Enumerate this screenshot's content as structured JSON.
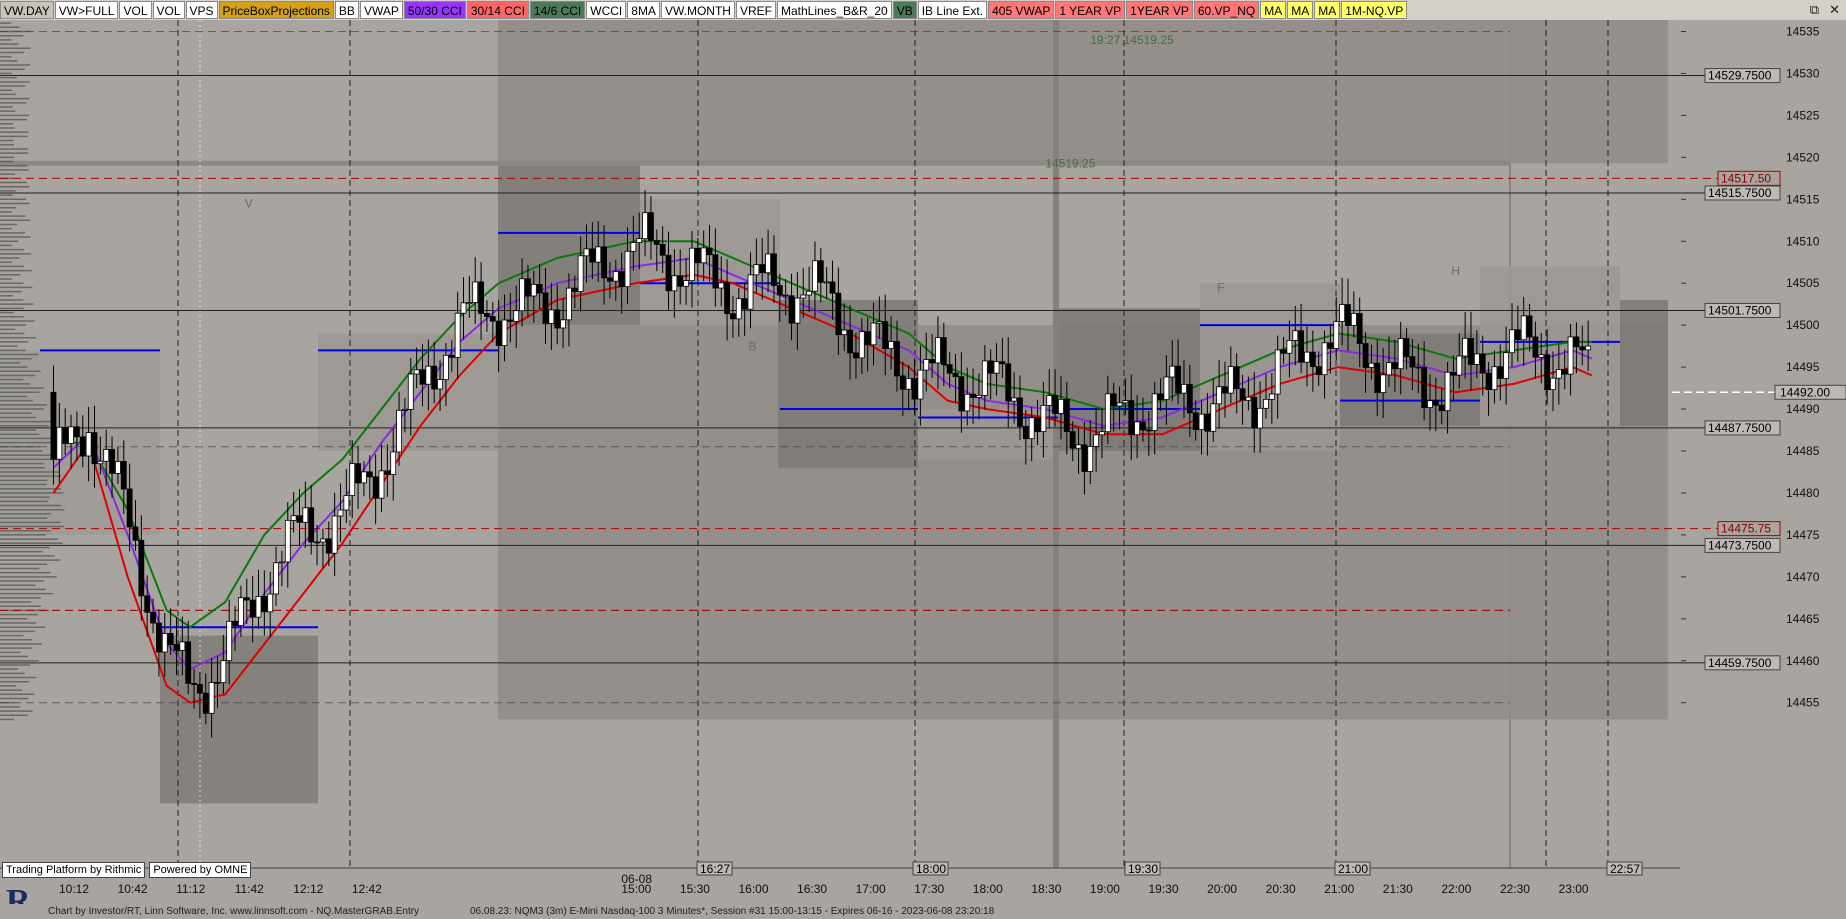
{
  "toolbar": {
    "buttons": [
      {
        "label": "VW.DAY",
        "bg": "#c8c4bc"
      },
      {
        "label": "VW>FULL",
        "bg": "#ffffff"
      },
      {
        "label": "VOL",
        "bg": "#ffffff"
      },
      {
        "label": "VOL",
        "bg": "#ffffff"
      },
      {
        "label": "VPS",
        "bg": "#ffffff"
      },
      {
        "label": "PriceBoxProjections",
        "bg": "#d4a017"
      },
      {
        "label": "BB",
        "bg": "#ffffff"
      },
      {
        "label": "VWAP",
        "bg": "#ffffff"
      },
      {
        "label": "50/30 CCI",
        "bg": "#9933ff"
      },
      {
        "label": "30/14 CCI",
        "bg": "#ff6666"
      },
      {
        "label": "14/6 CCI",
        "bg": "#4a7a5a"
      },
      {
        "label": "WCCI",
        "bg": "#ffffff"
      },
      {
        "label": "8MA",
        "bg": "#ffffff"
      },
      {
        "label": "VW.MONTH",
        "bg": "#ffffff"
      },
      {
        "label": "VREF",
        "bg": "#ffffff"
      },
      {
        "label": "MathLines_B&R_20",
        "bg": "#ffffff"
      },
      {
        "label": "VB",
        "bg": "#4a7a5a"
      },
      {
        "label": "IB Line Ext.",
        "bg": "#ffffff"
      },
      {
        "label": "405 VWAP",
        "bg": "#ff7777"
      },
      {
        "label": "1 YEAR VP",
        "bg": "#ff7777"
      },
      {
        "label": "1YEAR VP",
        "bg": "#ff7777"
      },
      {
        "label": "60.VP_NQ",
        "bg": "#ff7777"
      },
      {
        "label": "MA",
        "bg": "#ffff66"
      },
      {
        "label": "MA",
        "bg": "#ffff66"
      },
      {
        "label": "MA",
        "bg": "#ffff66"
      },
      {
        "label": "1M-NQ.VP",
        "bg": "#ffff66"
      }
    ],
    "window_controls": [
      "restore-icon",
      "close-icon"
    ]
  },
  "footer": {
    "credit": "Chart by Investor/RT, Linn Software, Inc. www.linnsoft.com - NQ.MasterGRAB.Entry",
    "session": "06.08.23: NQM3 (3m) E-Mini Nasdaq-100 3 Minutes*, Session #31 15:00-13:15 - Expires 06-16 - 2023-06-08 23:20:18",
    "platform": "Trading Platform by Rithmic",
    "powered": "Powered by OMNE"
  },
  "chart_data": {
    "type": "candlestick",
    "symbol": "NQM3",
    "timeframe": "3 Minutes",
    "price_axis": {
      "ticks": [
        14535,
        14530,
        14525,
        14520,
        14515,
        14510,
        14505,
        14500,
        14495,
        14490,
        14485,
        14480,
        14475,
        14470,
        14465,
        14460,
        14455
      ],
      "range": [
        14452.5,
        14537
      ]
    },
    "time_axis": {
      "ticks": [
        {
          "t": "10:12",
          "min": 612
        },
        {
          "t": "10:42",
          "min": 642
        },
        {
          "t": "11:12",
          "min": 672
        },
        {
          "t": "11:42",
          "min": 702
        },
        {
          "t": "12:12",
          "min": 732
        },
        {
          "t": "12:42",
          "min": 762
        },
        {
          "t": "15:00",
          "min": 900,
          "sub": "06-08"
        },
        {
          "t": "15:30",
          "min": 930
        },
        {
          "t": "16:00",
          "min": 960
        },
        {
          "t": "16:30",
          "min": 990
        },
        {
          "t": "17:00",
          "min": 1020
        },
        {
          "t": "17:30",
          "min": 1050
        },
        {
          "t": "18:00",
          "min": 1080
        },
        {
          "t": "18:30",
          "min": 1110
        },
        {
          "t": "19:00",
          "min": 1140
        },
        {
          "t": "19:30",
          "min": 1170
        },
        {
          "t": "20:00",
          "min": 1200
        },
        {
          "t": "20:30",
          "min": 1230
        },
        {
          "t": "21:00",
          "min": 1260
        },
        {
          "t": "21:30",
          "min": 1290
        },
        {
          "t": "22:00",
          "min": 1320
        },
        {
          "t": "22:30",
          "min": 1350
        },
        {
          "t": "23:00",
          "min": 1380
        }
      ],
      "session_markers": [
        "16:27",
        "18:00",
        "19:30",
        "21:00",
        "22:57"
      ]
    },
    "price_labels": [
      {
        "price": 14529.75,
        "text": "14529.7500",
        "style": "solid"
      },
      {
        "price": 14517.5,
        "text": "14517.50",
        "style": "red"
      },
      {
        "price": 14515.75,
        "text": "14515.7500",
        "style": "solid"
      },
      {
        "price": 14501.75,
        "text": "14501.7500",
        "style": "solid"
      },
      {
        "price": 14492,
        "text": "14492.00",
        "style": "current"
      },
      {
        "price": 14487.75,
        "text": "14487.7500",
        "style": "solid"
      },
      {
        "price": 14475.75,
        "text": "14475.75",
        "style": "red"
      },
      {
        "price": 14473.75,
        "text": "14473.7500",
        "style": "solid"
      },
      {
        "price": 14459.75,
        "text": "14459.7500",
        "style": "solid"
      }
    ],
    "annotations": [
      {
        "text": "19:27  14519.25",
        "min": 1133,
        "price": 14534
      },
      {
        "text": "14519.25",
        "min": 1110,
        "price": 14519.25
      }
    ],
    "period_letters": [
      {
        "letter": "V",
        "min": 702,
        "price": 14514
      },
      {
        "letter": "B",
        "min": 960,
        "price": 14497
      },
      {
        "letter": "F",
        "min": 1200,
        "price": 14504
      },
      {
        "letter": "H",
        "min": 1320,
        "price": 14506
      }
    ],
    "series": [
      {
        "name": "green",
        "color": "#0a7a0a",
        "points": [
          [
            602,
            14486
          ],
          [
            620,
            14486
          ],
          [
            640,
            14478
          ],
          [
            660,
            14466
          ],
          [
            672,
            14464
          ],
          [
            690,
            14467
          ],
          [
            710,
            14475
          ],
          [
            730,
            14480
          ],
          [
            750,
            14484
          ],
          [
            770,
            14490
          ],
          [
            790,
            14496
          ],
          [
            810,
            14501
          ],
          [
            830,
            14505
          ],
          [
            860,
            14508
          ],
          [
            900,
            14510
          ],
          [
            930,
            14510
          ],
          [
            950,
            14508
          ],
          [
            980,
            14505
          ],
          [
            1010,
            14502
          ],
          [
            1040,
            14499
          ],
          [
            1060,
            14495
          ],
          [
            1080,
            14493
          ],
          [
            1110,
            14492
          ],
          [
            1140,
            14490
          ],
          [
            1170,
            14491
          ],
          [
            1200,
            14494
          ],
          [
            1230,
            14497
          ],
          [
            1260,
            14499
          ],
          [
            1290,
            14498
          ],
          [
            1320,
            14496
          ],
          [
            1350,
            14497
          ],
          [
            1380,
            14498
          ],
          [
            1390,
            14498
          ]
        ]
      },
      {
        "name": "purple",
        "color": "#8a2be2",
        "points": [
          [
            602,
            14483
          ],
          [
            620,
            14487
          ],
          [
            640,
            14475
          ],
          [
            660,
            14462
          ],
          [
            672,
            14459
          ],
          [
            690,
            14461
          ],
          [
            710,
            14468
          ],
          [
            730,
            14474
          ],
          [
            750,
            14479
          ],
          [
            770,
            14486
          ],
          [
            790,
            14492
          ],
          [
            810,
            14498
          ],
          [
            830,
            14502
          ],
          [
            860,
            14505
          ],
          [
            900,
            14507
          ],
          [
            930,
            14508
          ],
          [
            950,
            14506
          ],
          [
            980,
            14503
          ],
          [
            1010,
            14500
          ],
          [
            1040,
            14497
          ],
          [
            1060,
            14493
          ],
          [
            1080,
            14491
          ],
          [
            1110,
            14490
          ],
          [
            1140,
            14488
          ],
          [
            1170,
            14489
          ],
          [
            1200,
            14492
          ],
          [
            1230,
            14495
          ],
          [
            1260,
            14497
          ],
          [
            1290,
            14496
          ],
          [
            1320,
            14494
          ],
          [
            1350,
            14495
          ],
          [
            1380,
            14497
          ],
          [
            1390,
            14496
          ]
        ]
      },
      {
        "name": "red",
        "color": "#e00000",
        "points": [
          [
            602,
            14480
          ],
          [
            620,
            14486
          ],
          [
            640,
            14470
          ],
          [
            660,
            14457
          ],
          [
            672,
            14455
          ],
          [
            690,
            14456
          ],
          [
            710,
            14462
          ],
          [
            730,
            14468
          ],
          [
            750,
            14474
          ],
          [
            770,
            14481
          ],
          [
            790,
            14488
          ],
          [
            810,
            14494
          ],
          [
            830,
            14499
          ],
          [
            860,
            14503
          ],
          [
            900,
            14505
          ],
          [
            930,
            14506
          ],
          [
            950,
            14505
          ],
          [
            980,
            14502
          ],
          [
            1010,
            14499
          ],
          [
            1040,
            14495
          ],
          [
            1060,
            14491
          ],
          [
            1080,
            14490
          ],
          [
            1110,
            14489
          ],
          [
            1140,
            14487
          ],
          [
            1170,
            14487
          ],
          [
            1200,
            14490
          ],
          [
            1230,
            14493
          ],
          [
            1260,
            14495
          ],
          [
            1290,
            14494
          ],
          [
            1320,
            14492
          ],
          [
            1350,
            14493
          ],
          [
            1380,
            14495
          ],
          [
            1390,
            14494
          ]
        ]
      }
    ]
  }
}
